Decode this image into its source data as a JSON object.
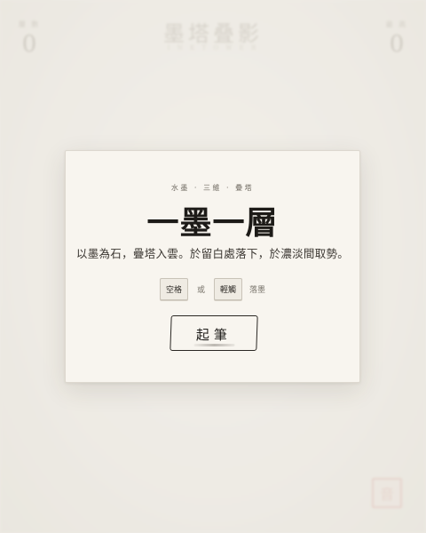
{
  "background": {
    "title": "墨塔叠影",
    "subtitle": "I N K   T O W E R",
    "hud_left": {
      "label": "層 數",
      "value": "0"
    },
    "hud_right": {
      "label": "最 高",
      "value": "0"
    },
    "seal_button": {
      "glyph": "音"
    }
  },
  "modal": {
    "eyebrow": "水墨 · 三維 · 疊塔",
    "headline": "一墨一層",
    "tagline": "以墨為石，疊塔入雲。於留白處落下，於濃淡間取勢。",
    "controls": {
      "key1": "空格",
      "or": "或",
      "key2": "輕觸",
      "action": "落墨"
    },
    "start_button": "起筆"
  }
}
